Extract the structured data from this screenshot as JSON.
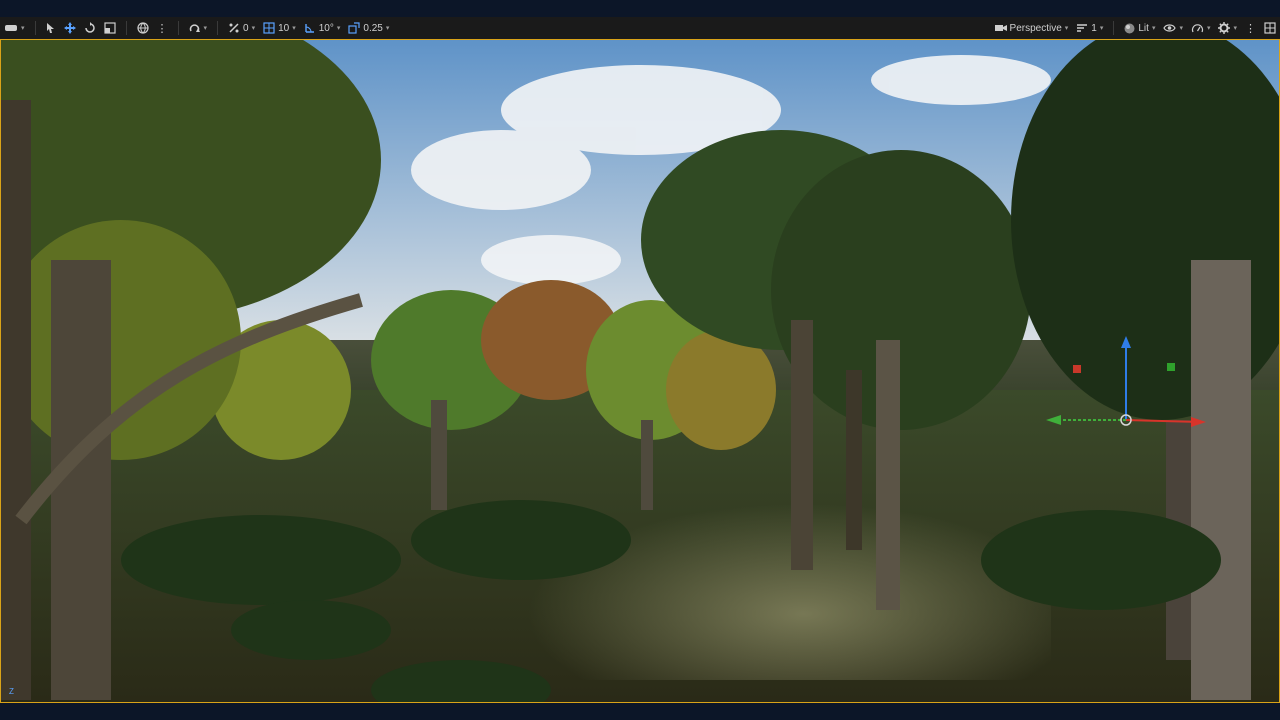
{
  "toolbar": {
    "left": {
      "transform_mode": "select",
      "rotation_snap_value": "0",
      "grid_snap_value": "10",
      "angle_snap_value": "10°",
      "scale_snap_value": "0.25"
    },
    "right": {
      "view_mode": "Perspective",
      "camera_speed": "1",
      "lighting_mode": "Lit"
    }
  },
  "viewport": {
    "accent": "#d9a318",
    "axis_label": "Z"
  }
}
